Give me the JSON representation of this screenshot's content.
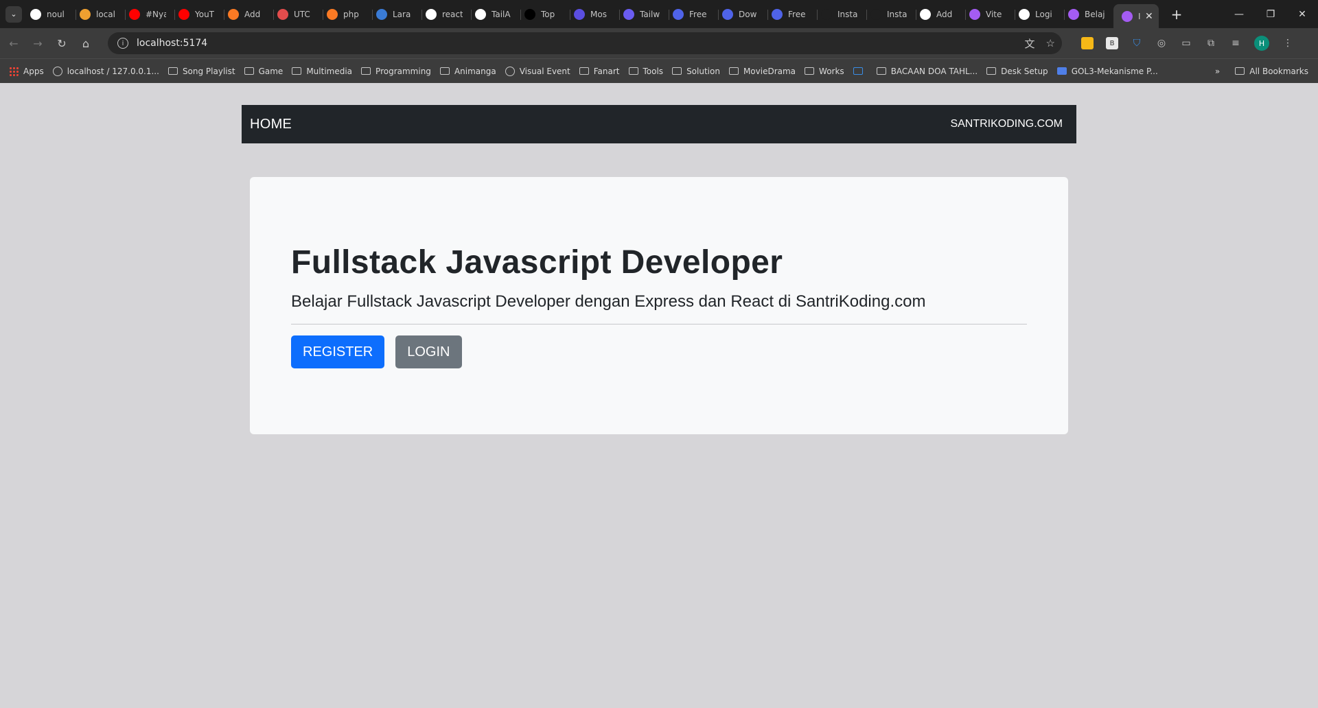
{
  "browser": {
    "tabs": [
      {
        "title": "noul",
        "favicon": "github-icon",
        "color": "#ffffff"
      },
      {
        "title": "local",
        "favicon": "phpmyadmin-icon",
        "color": "#f0a030"
      },
      {
        "title": "#Nya",
        "favicon": "youtube-icon",
        "color": "#ff0000"
      },
      {
        "title": "YouT",
        "favicon": "youtube-icon",
        "color": "#ff0000"
      },
      {
        "title": "Add",
        "favicon": "xampp-icon",
        "color": "#fb7a24"
      },
      {
        "title": "UTC",
        "favicon": "laravel-icon",
        "color": "#e34c4c"
      },
      {
        "title": "php",
        "favicon": "xampp-icon",
        "color": "#fb7a24"
      },
      {
        "title": "Lara",
        "favicon": "laravel-icon",
        "color": "#3a7bd5"
      },
      {
        "title": "react",
        "favicon": "google-icon",
        "color": "#ffffff"
      },
      {
        "title": "TailA",
        "favicon": "github-icon",
        "color": "#ffffff"
      },
      {
        "title": "Top",
        "favicon": "dev-icon",
        "color": "#000000"
      },
      {
        "title": "Mos",
        "favicon": "square-icon",
        "color": "#5b4ee0"
      },
      {
        "title": "Tailw",
        "favicon": "c-icon",
        "color": "#6a5cf0"
      },
      {
        "title": "Free",
        "favicon": "chart-icon",
        "color": "#4f63e8"
      },
      {
        "title": "Dow",
        "favicon": "chart-icon",
        "color": "#4f63e8"
      },
      {
        "title": "Free",
        "favicon": "chart-icon",
        "color": "#4f63e8"
      },
      {
        "title": "Insta",
        "favicon": "t-icon",
        "color": "#1f1f1f"
      },
      {
        "title": "Insta",
        "favicon": "t-icon",
        "color": "#1f1f1f"
      },
      {
        "title": "Add",
        "favicon": "chat-icon",
        "color": "#ffffff"
      },
      {
        "title": "Vite",
        "favicon": "vite-icon",
        "color": "#a45cf2"
      },
      {
        "title": "Logi",
        "favicon": "google-icon",
        "color": "#ffffff"
      },
      {
        "title": "Belaj",
        "favicon": "vite-icon",
        "color": "#a45cf2"
      }
    ],
    "active_tab": {
      "title": "I",
      "favicon": "vite-icon",
      "color": "#a45cf2"
    },
    "url": "localhost:5174",
    "avatar_letter": "H",
    "bookmarks": [
      {
        "label": "Apps",
        "icon": "apps-grid-icon"
      },
      {
        "label": "localhost / 127.0.0.1...",
        "icon": "globe-icon"
      },
      {
        "label": "Song Playlist",
        "icon": "folder-icon"
      },
      {
        "label": "Game",
        "icon": "folder-icon"
      },
      {
        "label": "Multimedia",
        "icon": "folder-icon"
      },
      {
        "label": "Programming",
        "icon": "folder-icon"
      },
      {
        "label": "Animanga",
        "icon": "folder-icon"
      },
      {
        "label": "Visual Event",
        "icon": "globe-icon"
      },
      {
        "label": "Fanart",
        "icon": "folder-icon"
      },
      {
        "label": "Tools",
        "icon": "folder-icon"
      },
      {
        "label": "Solution",
        "icon": "folder-icon"
      },
      {
        "label": "MovieDrama",
        "icon": "folder-icon"
      },
      {
        "label": "Works",
        "icon": "folder-icon"
      },
      {
        "label": "",
        "icon": "calendar-icon"
      },
      {
        "label": "BACAAN DOA TAHL...",
        "icon": "page-icon"
      },
      {
        "label": "Desk Setup",
        "icon": "folder-icon"
      },
      {
        "label": "GOL3-Mekanisme P...",
        "icon": "doc-icon"
      }
    ],
    "all_bookmarks": "All Bookmarks",
    "overflow": "»"
  },
  "navbar": {
    "brand": "HOME",
    "link": "SANTRIKODING.COM"
  },
  "hero": {
    "title": "Fullstack Javascript Developer",
    "lead": "Belajar Fullstack Javascript Developer dengan Express dan React di SantriKoding.com",
    "register_label": "REGISTER",
    "login_label": "LOGIN"
  }
}
